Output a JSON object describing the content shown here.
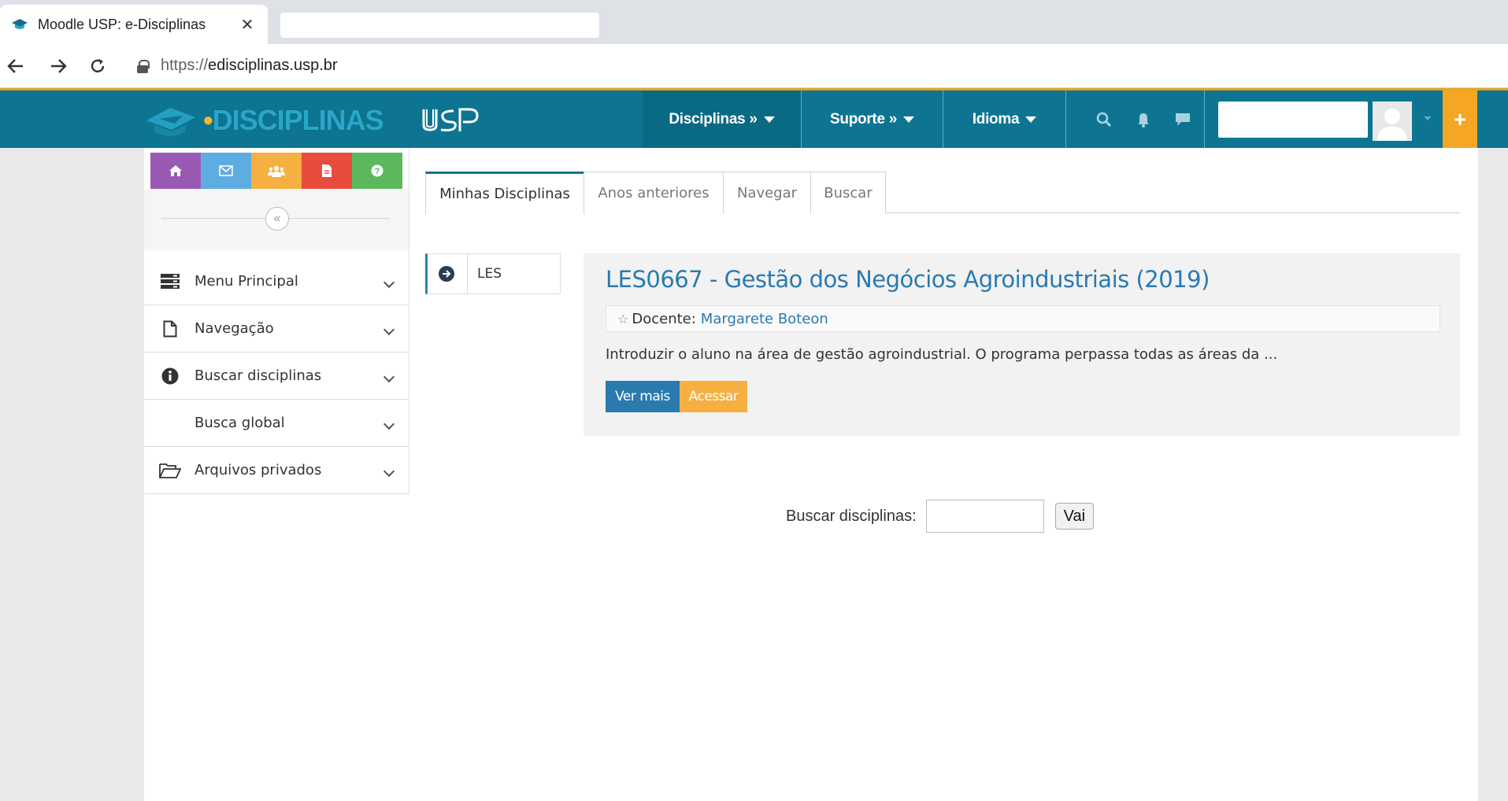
{
  "browser": {
    "tab_title": "Moodle USP: e-Disciplinas",
    "tab_close": "✕",
    "url_protocol": "https://",
    "url_host": "edisciplinas.usp.br"
  },
  "navbar": {
    "logo_dot": "•",
    "logo_text": "DISCIPLINAS",
    "menu": {
      "disciplinas": "Disciplinas »",
      "suporte": "Suporte »",
      "idioma": "Idioma"
    },
    "plus": "+"
  },
  "sidebar": {
    "collapse": "«",
    "items": [
      {
        "label": "Menu Principal"
      },
      {
        "label": "Navegação"
      },
      {
        "label": "Buscar disciplinas"
      },
      {
        "label": "Busca global"
      },
      {
        "label": "Arquivos privados"
      }
    ]
  },
  "tabs": [
    {
      "label": "Minhas Disciplinas"
    },
    {
      "label": "Anos anteriores"
    },
    {
      "label": "Navegar"
    },
    {
      "label": "Buscar"
    }
  ],
  "category": {
    "label": "LES"
  },
  "course": {
    "title": "LES0667 - Gestão dos Negócios Agroindustriais (2019)",
    "teacher_label": "Docente:",
    "teacher_name": "Margarete Boteon",
    "summary": "Introduzir o aluno na área de gestão agroindustrial. O programa perpassa todas as áreas da ...",
    "ver_mais": "Ver mais",
    "acessar": "Acessar"
  },
  "search": {
    "label": "Buscar disciplinas:",
    "value": "",
    "button": "Vai"
  },
  "colors": {
    "navbar": "#0d7591",
    "accent_orange": "#f5a623",
    "link_blue": "#2a7ab0"
  }
}
